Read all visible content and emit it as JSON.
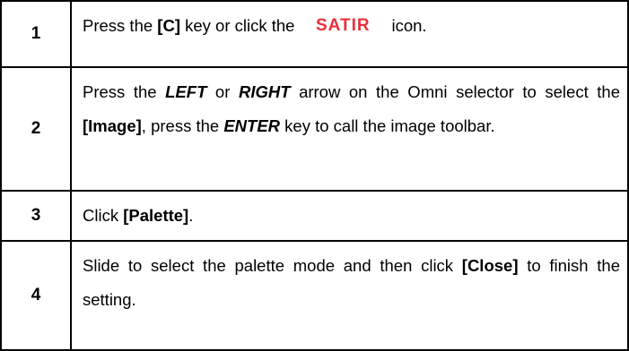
{
  "steps": [
    {
      "number": "1",
      "t1": "Press the ",
      "k1": "[C]",
      "t2": " key or click the",
      "logo_text": "SATIR",
      "logo_color": "#e8313a",
      "t3": "icon."
    },
    {
      "number": "2",
      "t1": "Press the ",
      "k1": "LEFT",
      "t2": " or ",
      "k2": "RIGHT",
      "t3": " arrow on the Omni selector to select the ",
      "k3": "[Image]",
      "t4": ", press the ",
      "k4": "ENTER",
      "t5": " key to call the image toolbar."
    },
    {
      "number": "3",
      "t1": "Click ",
      "k1": "[Palette]",
      "t2": "."
    },
    {
      "number": "4",
      "t1": "Slide to select the palette mode and then click ",
      "k1": "[Close]",
      "t2": " to finish the setting."
    }
  ]
}
